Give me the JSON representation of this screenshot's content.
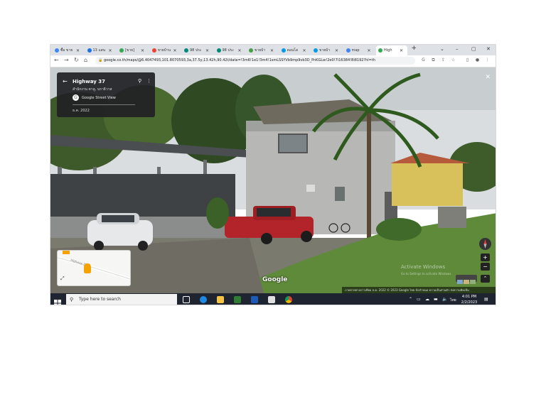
{
  "browser": {
    "tabs": [
      {
        "label": "ซื้อ ขาย",
        "color": "#4285f4"
      },
      {
        "label": "13 แสน",
        "color": "#1a73e8"
      },
      {
        "label": "[ขาย]",
        "color": "#34a853"
      },
      {
        "label": "ขายบ้าน",
        "color": "#ea4335"
      },
      {
        "label": "98 ประ",
        "color": "#00897b"
      },
      {
        "label": "98 ประ",
        "color": "#00897b"
      },
      {
        "label": "ขายบ้า",
        "color": "#43a047"
      },
      {
        "label": "คอนโด",
        "color": "#039be5"
      },
      {
        "label": "ขายบ้า",
        "color": "#039be5"
      },
      {
        "label": "map",
        "color": "#4285f4"
      },
      {
        "label": "High",
        "color": "#34a853"
      }
    ],
    "new_tab": "+",
    "url": "google.co.th/maps/@6.4047493,101.8070593,3a,37.5y,13.42h,90.42t/data=!3m6!1e1!3m4!1smLSSYVb9mp9vb3D_PnKGLw!2e0!7i16384!8i8192?hl=th",
    "window": {
      "minimize": "–",
      "maximize": "▢",
      "close": "✕",
      "chevron": "⌄"
    }
  },
  "streetview": {
    "title": "Highway 37",
    "subtitle": "สำนักงาน ตาลู, นราธิวาส",
    "service": "Google Street View",
    "date": "ธ.ค. 2022",
    "close": "✕",
    "logo": "Google",
    "watermark_line1": "Activate Windows",
    "watermark_line2": "Go to Settings to activate Windows.",
    "footer": "ภาพถ่ายทางดาวเทียม ธ.ค. 2022   © 2023 Google   ไทย   ข้อกำหนด   ความเป็นส่วนตัว   ส่งความคิดเห็น",
    "minimap_label": "Highway 37",
    "zoom_in": "+",
    "zoom_out": "−"
  },
  "taskbar": {
    "search_placeholder": "Type here to search",
    "time": "4:01 PM",
    "date": "2/2/2023",
    "lang": "ไทย",
    "notif": "6"
  }
}
